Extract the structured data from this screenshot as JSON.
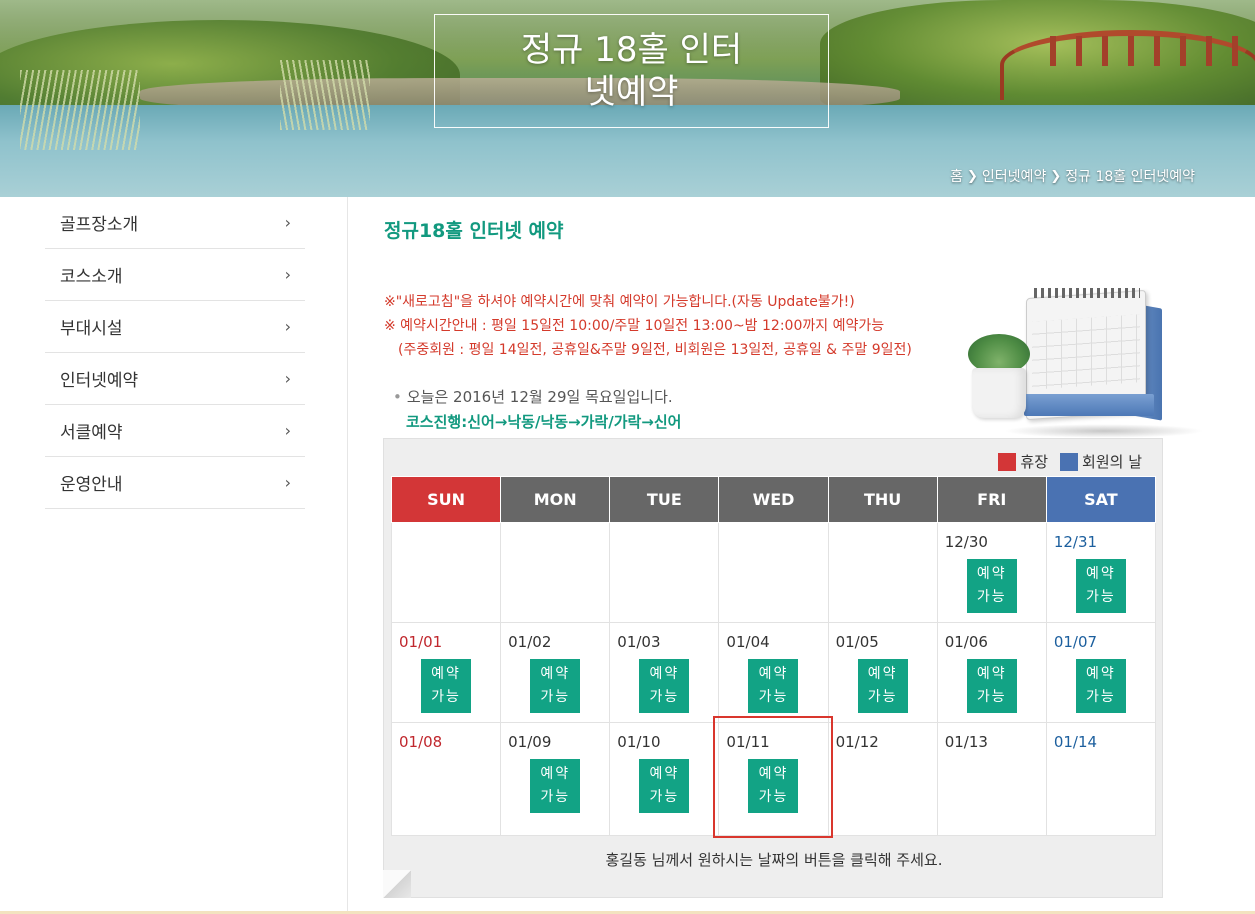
{
  "hero": {
    "title_line1": "정규 18홀 인터",
    "title_line2": "넷예약",
    "breadcrumb": [
      "홈",
      "인터넷예약",
      "정규 18홀 인터넷예약"
    ]
  },
  "sidebar": {
    "items": [
      {
        "label": "골프장소개"
      },
      {
        "label": "코스소개"
      },
      {
        "label": "부대시설"
      },
      {
        "label": "인터넷예약"
      },
      {
        "label": "서클예약"
      },
      {
        "label": "운영안내"
      }
    ]
  },
  "main": {
    "title": "정규18홀 인터넷 예약",
    "notice_line1": "※\"새로고침\"을 하셔야 예약시간에 맞춰 예약이 가능합니다.(자동 Update불가!)",
    "notice_line2": "※ 예약시간안내 : 평일 15일전 10:00/주말 10일전 13:00~밤 12:00까지 예약가능",
    "notice_line3": "(주중회원 : 평일 14일전, 공휴일&주말 9일전, 비회원은 13일전, 공휴일 & 주말 9일전)",
    "today": "오늘은 2016년 12월 29일 목요일입니다.",
    "course": "코스진행:신어→낙동/낙동→가락/가락→신어",
    "help": "홍길동 님께서 원하시는 날짜의 버튼을 클릭해 주세요."
  },
  "legend": [
    {
      "label": "휴장",
      "color": "#d33637"
    },
    {
      "label": "회원의 날",
      "color": "#4a72b2"
    }
  ],
  "calendar": {
    "headers": [
      "SUN",
      "MON",
      "TUE",
      "WED",
      "THU",
      "FRI",
      "SAT"
    ],
    "button_line1": "예약",
    "button_line2": "가능",
    "weeks": [
      [
        {
          "date": "",
          "available": false
        },
        {
          "date": "",
          "available": false
        },
        {
          "date": "",
          "available": false
        },
        {
          "date": "",
          "available": false
        },
        {
          "date": "",
          "available": false
        },
        {
          "date": "12/30",
          "available": true
        },
        {
          "date": "12/31",
          "available": true
        }
      ],
      [
        {
          "date": "01/01",
          "available": true
        },
        {
          "date": "01/02",
          "available": true
        },
        {
          "date": "01/03",
          "available": true
        },
        {
          "date": "01/04",
          "available": true
        },
        {
          "date": "01/05",
          "available": true
        },
        {
          "date": "01/06",
          "available": true
        },
        {
          "date": "01/07",
          "available": true
        }
      ],
      [
        {
          "date": "01/08",
          "available": false
        },
        {
          "date": "01/09",
          "available": true
        },
        {
          "date": "01/10",
          "available": true
        },
        {
          "date": "01/11",
          "available": true
        },
        {
          "date": "01/12",
          "available": false
        },
        {
          "date": "01/13",
          "available": false
        },
        {
          "date": "01/14",
          "available": false
        }
      ]
    ]
  },
  "colors": {
    "accent": "#12a385",
    "title_green": "#12997f",
    "notice_red": "#d43a2b",
    "sunday_red": "#c0272d",
    "saturday_blue": "#1c5f9e"
  }
}
